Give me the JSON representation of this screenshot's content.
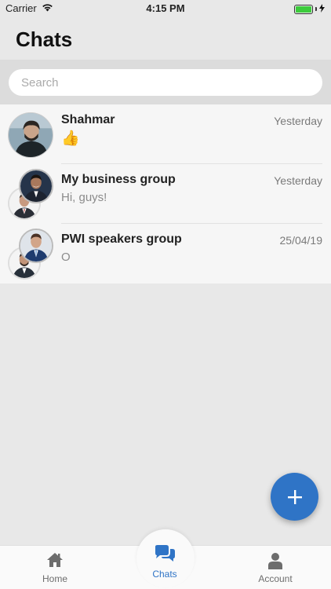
{
  "status_bar": {
    "carrier": "Carrier",
    "time": "4:15 PM"
  },
  "header": {
    "title": "Chats"
  },
  "search": {
    "placeholder": "Search"
  },
  "chats": [
    {
      "name": "Shahmar",
      "date": "Yesterday",
      "preview": "👍"
    },
    {
      "name": "My business group",
      "date": "Yesterday",
      "preview": "Hi, guys!"
    },
    {
      "name": "PWI speakers group",
      "date": "25/04/19",
      "preview": "O"
    }
  ],
  "tabs": [
    {
      "label": "Home",
      "icon": "home-icon"
    },
    {
      "label": "Chats",
      "icon": "chat-bubbles-icon"
    },
    {
      "label": "Account",
      "icon": "person-icon"
    }
  ],
  "colors": {
    "accent": "#2f74c6",
    "background": "#e8e8e8",
    "battery": "#3ccb3c"
  }
}
